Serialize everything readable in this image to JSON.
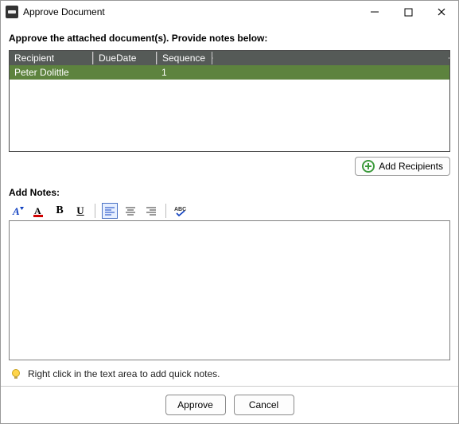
{
  "window": {
    "title": "Approve Document"
  },
  "instruction": "Approve the attached document(s). Provide notes below:",
  "grid": {
    "headers": {
      "recipient": "Recipient",
      "duedate": "DueDate",
      "sequence": "Sequence"
    },
    "rows": [
      {
        "recipient": "Peter Dolittle",
        "duedate": "",
        "sequence": "1"
      }
    ]
  },
  "buttons": {
    "add_recipients": "Add Recipients",
    "approve": "Approve",
    "cancel": "Cancel"
  },
  "notes": {
    "label": "Add Notes:",
    "value": "",
    "hint": "Right click in the text area to add quick notes."
  }
}
